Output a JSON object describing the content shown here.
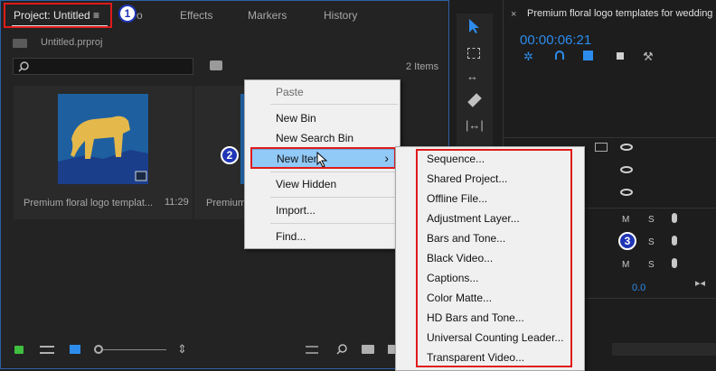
{
  "project_panel": {
    "tabs": [
      "Project: Untitled",
      "Effects",
      "Markers",
      "History"
    ],
    "tab_menu_icon": "≡",
    "tab_partial": "o",
    "file_name": "Untitled.prproj",
    "items_count": "2 Items",
    "clip1": {
      "name": "Premium floral logo templat...",
      "duration": "11:29"
    },
    "clip2": {
      "name": "Premium"
    }
  },
  "badges": [
    "1",
    "2",
    "3"
  ],
  "context_menu": {
    "items": [
      {
        "label": "Paste",
        "disabled": true
      },
      {
        "label": "New Bin"
      },
      {
        "label": "New Search Bin"
      },
      {
        "label": "New Item",
        "highlighted": true
      },
      {
        "label": "View Hidden"
      },
      {
        "label": "Import..."
      },
      {
        "label": "Find..."
      }
    ],
    "arrow": "›"
  },
  "submenu": {
    "items": [
      "Sequence...",
      "Shared Project...",
      "Offline File...",
      "Adjustment Layer...",
      "Bars and Tone...",
      "Black Video...",
      "Captions...",
      "Color Matte...",
      "HD Bars and Tone...",
      "Universal Counting Leader...",
      "Transparent Video..."
    ]
  },
  "timeline": {
    "title": "Premium floral logo templates for wedding",
    "close": "×",
    "timecode": "00:00:06:21",
    "value": "0.0",
    "m": "M",
    "s": "S"
  },
  "colors": {
    "accent": "#2d8ceb",
    "highlight_red": "#e01b1b",
    "badge_blue": "#1f35b5",
    "menu_hover": "#91c9f7"
  }
}
